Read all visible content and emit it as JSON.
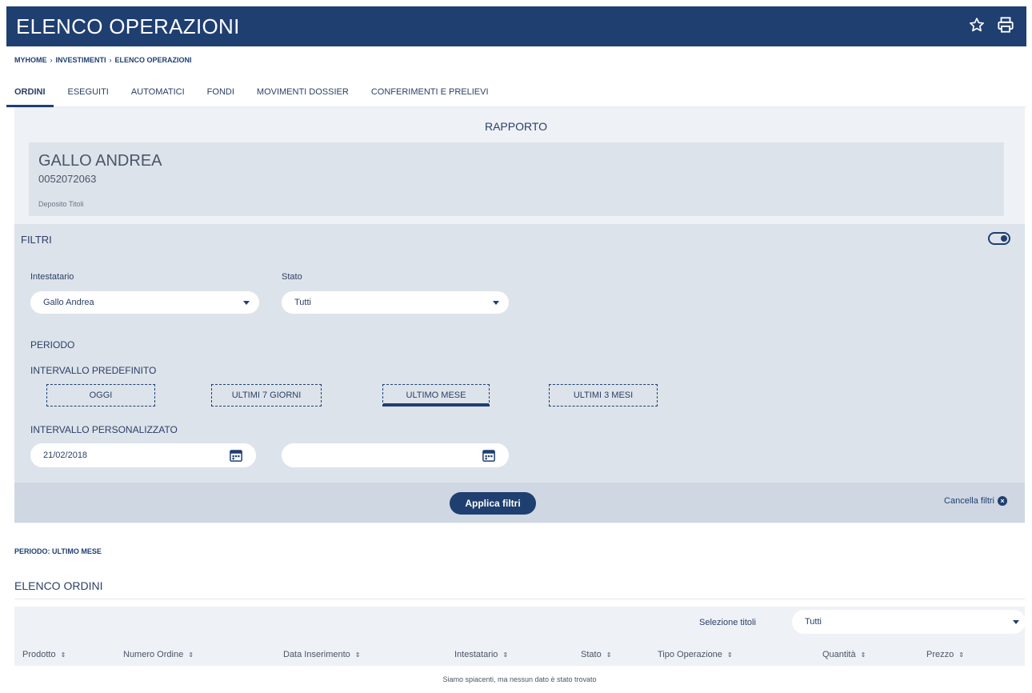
{
  "header": {
    "title": "ELENCO OPERAZIONI",
    "icons": [
      "star-outline-icon",
      "printer-icon"
    ]
  },
  "breadcrumb": [
    "MYHOME",
    "INVESTIMENTI",
    "ELENCO OPERAZIONI"
  ],
  "breadcrumb_separator": "›",
  "tabs": [
    {
      "label": "ORDINI",
      "active": true
    },
    {
      "label": "ESEGUITI",
      "active": false
    },
    {
      "label": "AUTOMATICI",
      "active": false
    },
    {
      "label": "FONDI",
      "active": false
    },
    {
      "label": "MOVIMENTI DOSSIER",
      "active": false
    },
    {
      "label": "CONFERIMENTI E PRELIEVI",
      "active": false
    }
  ],
  "rapporto": {
    "label": "RAPPORTO",
    "name": "GALLO ANDREA",
    "number": "0052072063",
    "type": "Deposito Titoli"
  },
  "filters": {
    "title": "FILTRI",
    "intestatario": {
      "label": "Intestatario",
      "value": "Gallo Andrea"
    },
    "stato": {
      "label": "Stato",
      "value": "Tutti"
    },
    "periodo_label": "PERIODO",
    "intervallo_predefinito_label": "INTERVALLO PREDEFINITO",
    "periods": [
      {
        "label": "OGGI",
        "active": false
      },
      {
        "label": "ULTIMI 7 GIORNI",
        "active": false
      },
      {
        "label": "ULTIMO MESE",
        "active": true
      },
      {
        "label": "ULTIMI 3 MESI",
        "active": false
      }
    ],
    "intervallo_personalizzato_label": "INTERVALLO PERSONALIZZATO",
    "date_from": "21/02/2018",
    "date_to": "",
    "apply_label": "Applica filtri",
    "cancel_label": "Cancella filtri"
  },
  "periodo_note": "PERIODO: ULTIMO MESE",
  "elenco_title": "ELENCO ORDINI",
  "selezione_titoli": {
    "label": "Selezione titoli",
    "value": "Tutti"
  },
  "table": {
    "columns": [
      "Prodotto",
      "Numero Ordine",
      "Data Inserimento",
      "Intestatario",
      "Stato",
      "Tipo Operazione",
      "Quantità",
      "Prezzo"
    ],
    "empty_message": "Siamo spiacenti, ma nessun dato è stato trovato"
  },
  "colors": {
    "primary": "#1f3f71",
    "panel": "#eef1f5",
    "card": "#dde3ea"
  }
}
